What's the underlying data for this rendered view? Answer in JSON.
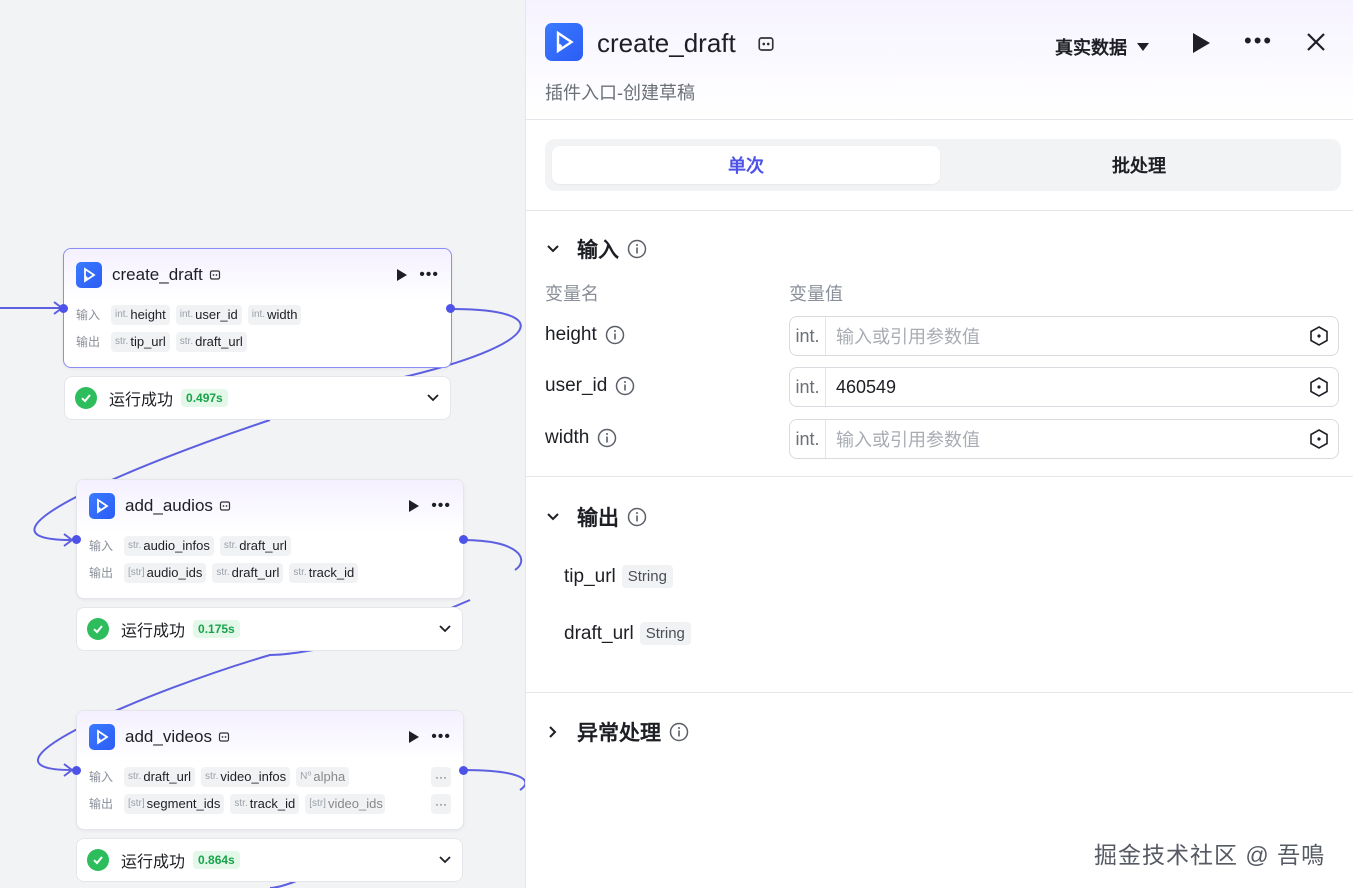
{
  "canvas": {
    "nodes": [
      {
        "id": "create_draft",
        "title": "create_draft",
        "selected": true,
        "input_label": "输入",
        "output_label": "输出",
        "inputs": [
          {
            "type": "int.",
            "name": "height"
          },
          {
            "type": "int.",
            "name": "user_id"
          },
          {
            "type": "int.",
            "name": "width"
          }
        ],
        "outputs": [
          {
            "type": "str.",
            "name": "tip_url"
          },
          {
            "type": "str.",
            "name": "draft_url"
          }
        ],
        "status": "运行成功",
        "duration": "0.497s"
      },
      {
        "id": "add_audios",
        "title": "add_audios",
        "selected": false,
        "input_label": "输入",
        "output_label": "输出",
        "inputs": [
          {
            "type": "str.",
            "name": "audio_infos"
          },
          {
            "type": "str.",
            "name": "draft_url"
          }
        ],
        "outputs": [
          {
            "type": "[str]",
            "name": "audio_ids"
          },
          {
            "type": "str.",
            "name": "draft_url"
          },
          {
            "type": "str.",
            "name": "track_id"
          }
        ],
        "status": "运行成功",
        "duration": "0.175s"
      },
      {
        "id": "add_videos",
        "title": "add_videos",
        "selected": false,
        "input_label": "输入",
        "output_label": "输出",
        "inputs": [
          {
            "type": "str.",
            "name": "draft_url"
          },
          {
            "type": "str.",
            "name": "video_infos"
          },
          {
            "type": "N⁰",
            "name": "alpha"
          }
        ],
        "outputs": [
          {
            "type": "[str]",
            "name": "segment_ids"
          },
          {
            "type": "str.",
            "name": "track_id"
          },
          {
            "type": "[str]",
            "name": "video_ids"
          }
        ],
        "more": "···",
        "status": "运行成功",
        "duration": "0.864s"
      }
    ]
  },
  "panel": {
    "title": "create_draft",
    "description": "插件入口-创建草稿",
    "data_mode": "真实数据",
    "tabs": [
      {
        "label": "单次",
        "active": true
      },
      {
        "label": "批处理",
        "active": false
      }
    ],
    "input_section": {
      "title": "输入",
      "col_name": "变量名",
      "col_value": "变量值",
      "vars": [
        {
          "name": "height",
          "type": "int.",
          "value": "",
          "placeholder": "输入或引用参数值"
        },
        {
          "name": "user_id",
          "type": "int.",
          "value": "460549",
          "placeholder": ""
        },
        {
          "name": "width",
          "type": "int.",
          "value": "",
          "placeholder": "输入或引用参数值"
        }
      ]
    },
    "output_section": {
      "title": "输出",
      "vars": [
        {
          "name": "tip_url",
          "type": "String"
        },
        {
          "name": "draft_url",
          "type": "String"
        }
      ]
    },
    "exception_section": {
      "title": "异常处理"
    }
  },
  "watermark": "掘金技术社区 @ 吾鳴",
  "colors": {
    "accent": "#4d53e8",
    "success": "#2dbd5c",
    "plugin_icon": "#2c5cf5",
    "edge": "#5b5fe0"
  }
}
